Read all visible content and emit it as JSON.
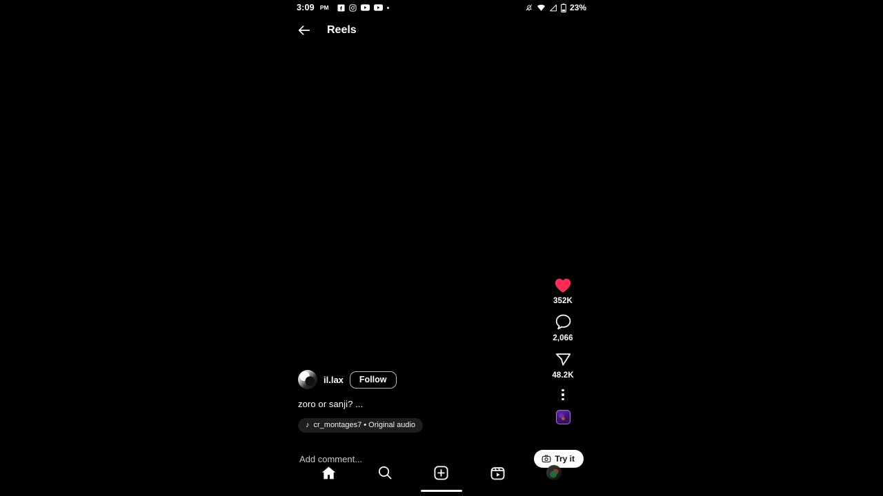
{
  "status_bar": {
    "time": "3:09",
    "ampm": "PM",
    "notification_icons": [
      "facebook-icon",
      "instagram-icon",
      "youtube-icon",
      "youtube-icon",
      "overflow-dot-icon"
    ],
    "system_icons": [
      "bell-muted-icon",
      "wifi-icon",
      "signal-icon",
      "battery-icon"
    ],
    "battery_percent": "23%"
  },
  "header": {
    "back_label": "Back",
    "title": "Reels"
  },
  "actions": {
    "like": {
      "icon": "heart-icon",
      "count": "352K",
      "color": "#ff2d55",
      "liked": true
    },
    "comment": {
      "icon": "comment-icon",
      "count": "2,066"
    },
    "share": {
      "icon": "share-icon",
      "count": "48.2K"
    },
    "more": {
      "icon": "more-vertical-icon"
    },
    "audio_cover": {
      "icon": "audio-thumbnail"
    }
  },
  "post": {
    "avatar": "user-avatar",
    "username": "il.lax",
    "follow_label": "Follow",
    "caption": "zoro or sanji? ...",
    "audio": {
      "icon": "music-note-icon",
      "label": "cr_montages7 • Original audio"
    }
  },
  "comment_bar": {
    "placeholder": "Add comment...",
    "value": "",
    "try_it_label": "Try it",
    "try_it_icon": "camera-icon"
  },
  "bottom_nav": {
    "items": [
      {
        "name": "home",
        "icon": "home-icon",
        "active": true
      },
      {
        "name": "search",
        "icon": "search-icon",
        "active": false
      },
      {
        "name": "create",
        "icon": "plus-square-icon",
        "active": false
      },
      {
        "name": "reels",
        "icon": "reels-icon",
        "active": false
      },
      {
        "name": "profile",
        "icon": "profile-avatar-icon",
        "active": false
      }
    ]
  },
  "theme": {
    "background": "#000000",
    "text": "#ffffff",
    "accent_like": "#ff2d55",
    "audio_pill_bg": "#1e1e1e"
  }
}
